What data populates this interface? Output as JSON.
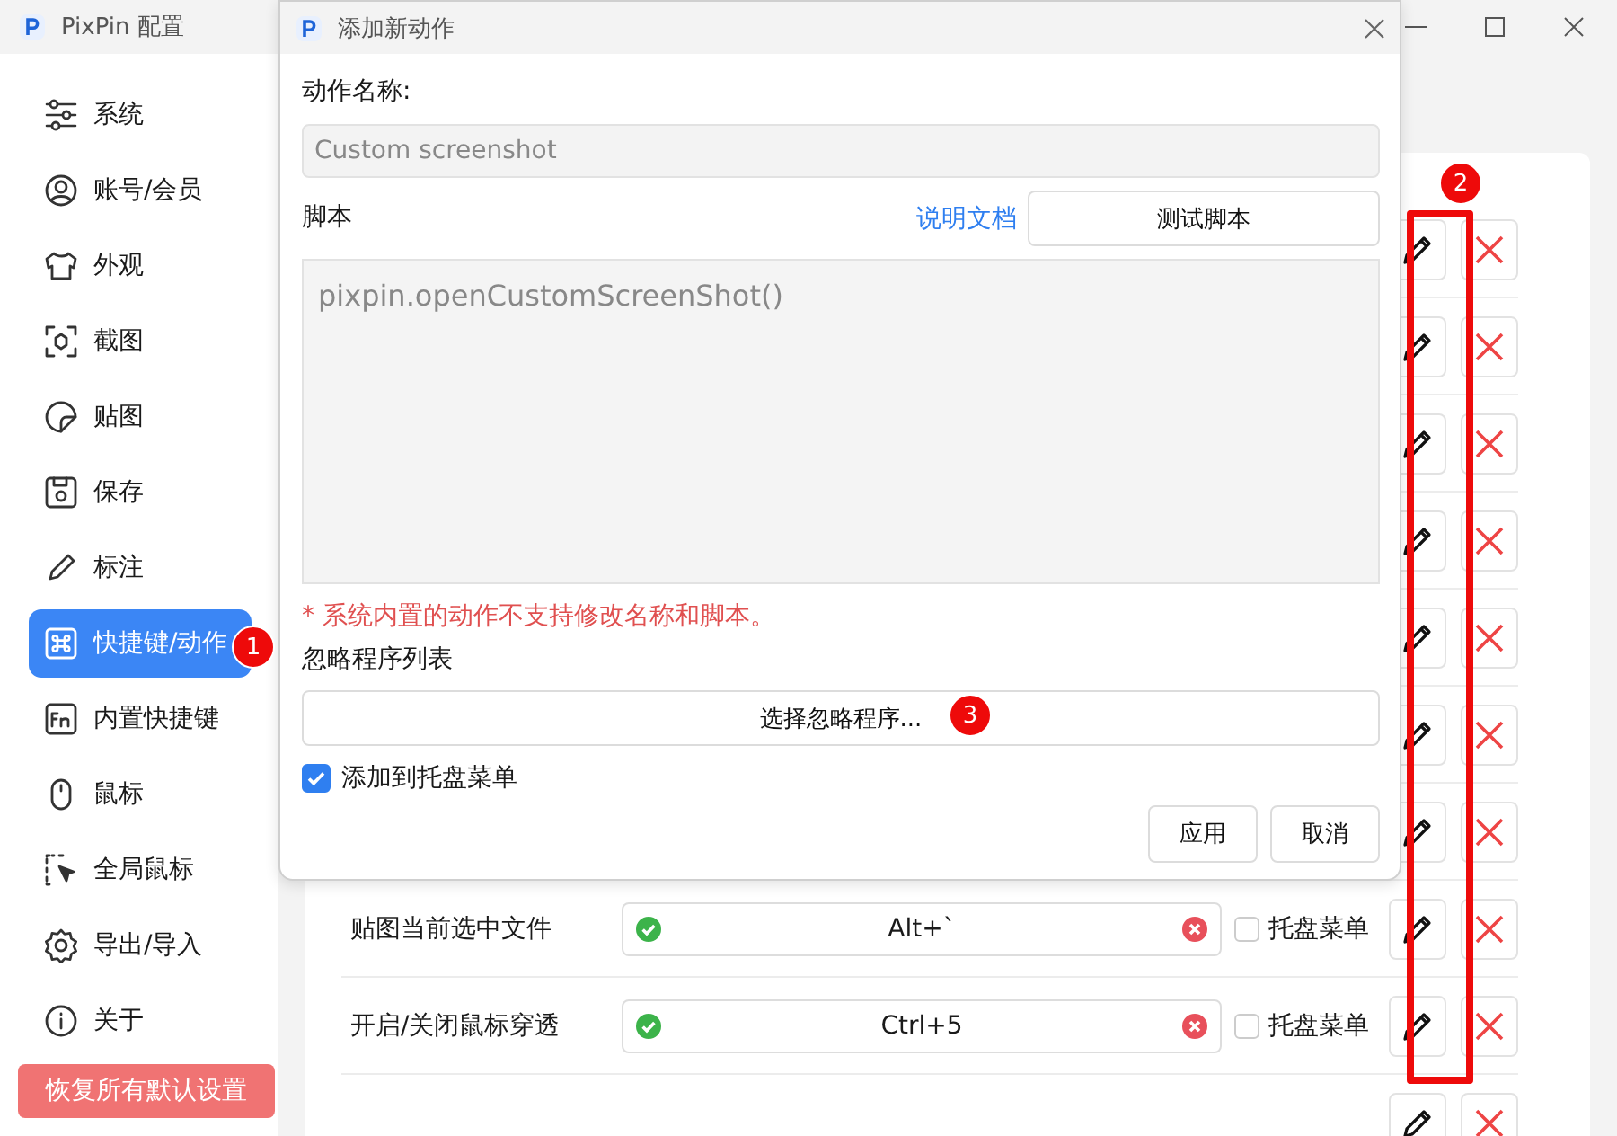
{
  "window": {
    "title": "PixPin 配置"
  },
  "sidebar": {
    "items": [
      {
        "label": "系统",
        "selected": false
      },
      {
        "label": "账号/会员",
        "selected": false
      },
      {
        "label": "外观",
        "selected": false
      },
      {
        "label": "截图",
        "selected": false
      },
      {
        "label": "贴图",
        "selected": false
      },
      {
        "label": "保存",
        "selected": false
      },
      {
        "label": "标注",
        "selected": false
      },
      {
        "label": "快捷键/动作",
        "selected": true
      },
      {
        "label": "内置快捷键",
        "selected": false
      },
      {
        "label": "鼠标",
        "selected": false
      },
      {
        "label": "全局鼠标",
        "selected": false
      },
      {
        "label": "导出/导入",
        "selected": false
      },
      {
        "label": "关于",
        "selected": false
      }
    ],
    "reset_button": "恢复所有默认设置"
  },
  "actions": [
    {
      "kind": "covered"
    },
    {
      "kind": "covered"
    },
    {
      "kind": "covered"
    },
    {
      "kind": "covered"
    },
    {
      "kind": "covered"
    },
    {
      "kind": "covered"
    },
    {
      "kind": "covered"
    },
    {
      "kind": "shortcut",
      "name": "贴图当前选中文件",
      "shortcut": "Alt+`",
      "valid": true,
      "tray_label": "托盘菜单",
      "tray_checked": false
    },
    {
      "kind": "shortcut",
      "name": "开启/关闭鼠标穿透",
      "shortcut": "Ctrl+5",
      "valid": true,
      "tray_label": "托盘菜单",
      "tray_checked": false
    },
    {
      "kind": "covered"
    }
  ],
  "dialog": {
    "title": "添加新动作",
    "name_label": "动作名称:",
    "name_value": "Custom screenshot",
    "script_label": "脚本",
    "docs_link": "说明文档",
    "test_button": "测试脚本",
    "script_value": "pixpin.openCustomScreenShot()",
    "warning": "* 系统内置的动作不支持修改名称和脚本。",
    "ignore_label": "忽略程序列表",
    "ignore_button": "选择忽略程序...",
    "tray_checkbox": {
      "label": "添加到托盘菜单",
      "checked": true
    },
    "buttons": [
      "应用",
      "取消"
    ]
  },
  "annotations": [
    {
      "label": "1"
    },
    {
      "label": "2"
    },
    {
      "label": "3"
    }
  ]
}
